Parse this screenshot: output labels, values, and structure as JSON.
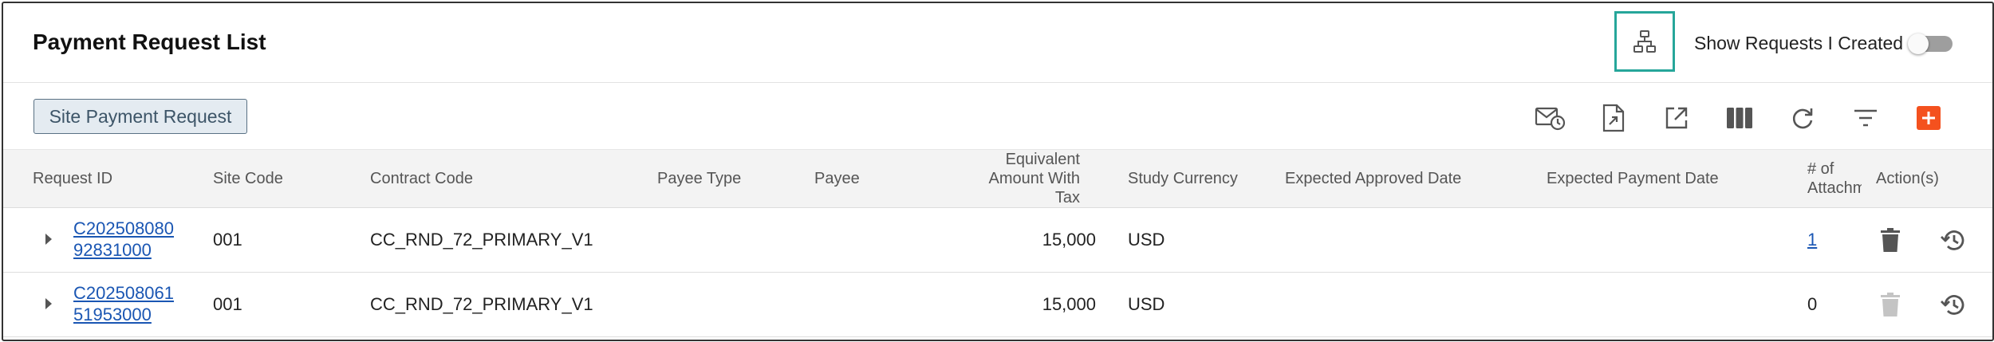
{
  "header": {
    "title": "Payment Request List",
    "org_chart_icon": "org-chart-icon",
    "show_requests_label": "Show Requests I Created",
    "show_requests_toggle_on": false
  },
  "toolbar": {
    "site_payment_button": "Site Payment Request",
    "icons": [
      "mail-schedule-icon",
      "export-document-icon",
      "open-external-icon",
      "columns-icon",
      "refresh-icon",
      "filter-icon",
      "add-icon"
    ],
    "accent_color": "#f4511e"
  },
  "table": {
    "columns": {
      "request_id": "Request ID",
      "site_code": "Site Code",
      "contract_code": "Contract Code",
      "payee_type": "Payee Type",
      "payee": "Payee",
      "equiv_line1": "Equivalent",
      "equiv_line2": "Amount With",
      "equiv_line3": "Tax",
      "study_currency": "Study Currency",
      "expected_approved_date": "Expected Approved Date",
      "expected_payment_date": "Expected Payment Date",
      "attach_line1": "# of",
      "attach_line2": "Attachm",
      "actions": "Action(s)"
    },
    "rows": [
      {
        "request_id_line1": "C202508080",
        "request_id_line2": "92831000",
        "site_code": "001",
        "contract_code": "CC_RND_72_PRIMARY_V1",
        "payee_type": "",
        "payee": "",
        "amount": "15,000",
        "currency": "USD",
        "expected_approved_date": "",
        "expected_payment_date": "",
        "attachments": "1",
        "delete_enabled": true
      },
      {
        "request_id_line1": "C202508061",
        "request_id_line2": "51953000",
        "site_code": "001",
        "contract_code": "CC_RND_72_PRIMARY_V1",
        "payee_type": "",
        "payee": "",
        "amount": "15,000",
        "currency": "USD",
        "expected_approved_date": "",
        "expected_payment_date": "",
        "attachments": "0",
        "delete_enabled": false
      }
    ]
  }
}
